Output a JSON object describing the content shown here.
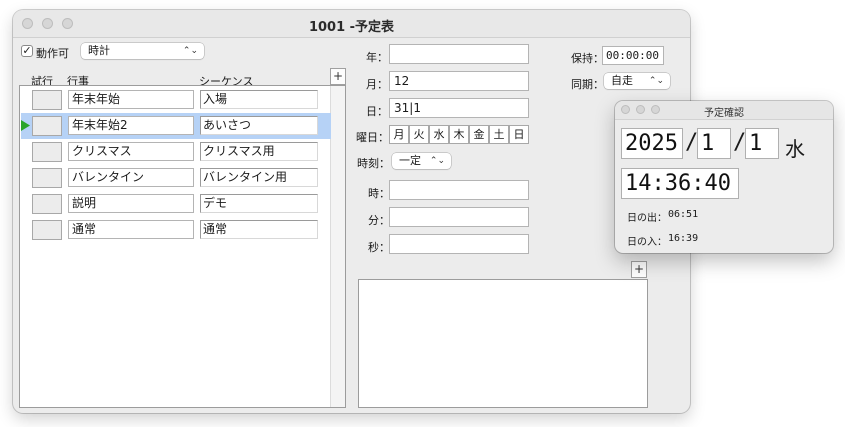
{
  "window": {
    "title": "1001 -予定表"
  },
  "toolbar": {
    "action_enabled_label": "動作可",
    "action_enabled_checked": true,
    "mode_select_value": "時計"
  },
  "table": {
    "headers": {
      "try": "試行",
      "event": "行事",
      "sequence": "シーケンス"
    },
    "add_label": "+",
    "rows": [
      {
        "event": "年末年始",
        "sequence": "入場"
      },
      {
        "event": "年末年始2",
        "sequence": "あいさつ"
      },
      {
        "event": "クリスマス",
        "sequence": "クリスマス用"
      },
      {
        "event": "バレンタイン",
        "sequence": "バレンタイン用"
      },
      {
        "event": "説明",
        "sequence": "デモ"
      },
      {
        "event": "通常",
        "sequence": "通常"
      }
    ],
    "selected_index": 1
  },
  "form": {
    "year_label": "年：",
    "year_value": "",
    "month_label": "月：",
    "month_value": "12",
    "day_label": "日：",
    "day_value": "31|1",
    "weekday_label": "曜日：",
    "weekdays": [
      "月",
      "火",
      "水",
      "木",
      "金",
      "土",
      "日"
    ],
    "time_label": "時刻：",
    "time_mode_value": "一定",
    "hour_label": "時：",
    "hour_value": "",
    "minute_label": "分：",
    "minute_value": "",
    "second_label": "秒：",
    "second_value": "",
    "add_label": "+"
  },
  "right": {
    "hold_label": "保持：",
    "hold_value": "00:00:00",
    "sync_label": "同期：",
    "sync_value": "自走"
  },
  "confirm_window": {
    "title": "予定確認",
    "year": "2025",
    "month": "1",
    "day": "1",
    "date_sep": "/",
    "weekday": "水",
    "time": "14:36:40",
    "sunrise_label": "日の出：",
    "sunrise_value": "06:51",
    "sunset_label": "日の入：",
    "sunset_value": "16:39"
  },
  "colors": {
    "selection": "#b6d2f6",
    "row_marker": "#2aa52a"
  }
}
